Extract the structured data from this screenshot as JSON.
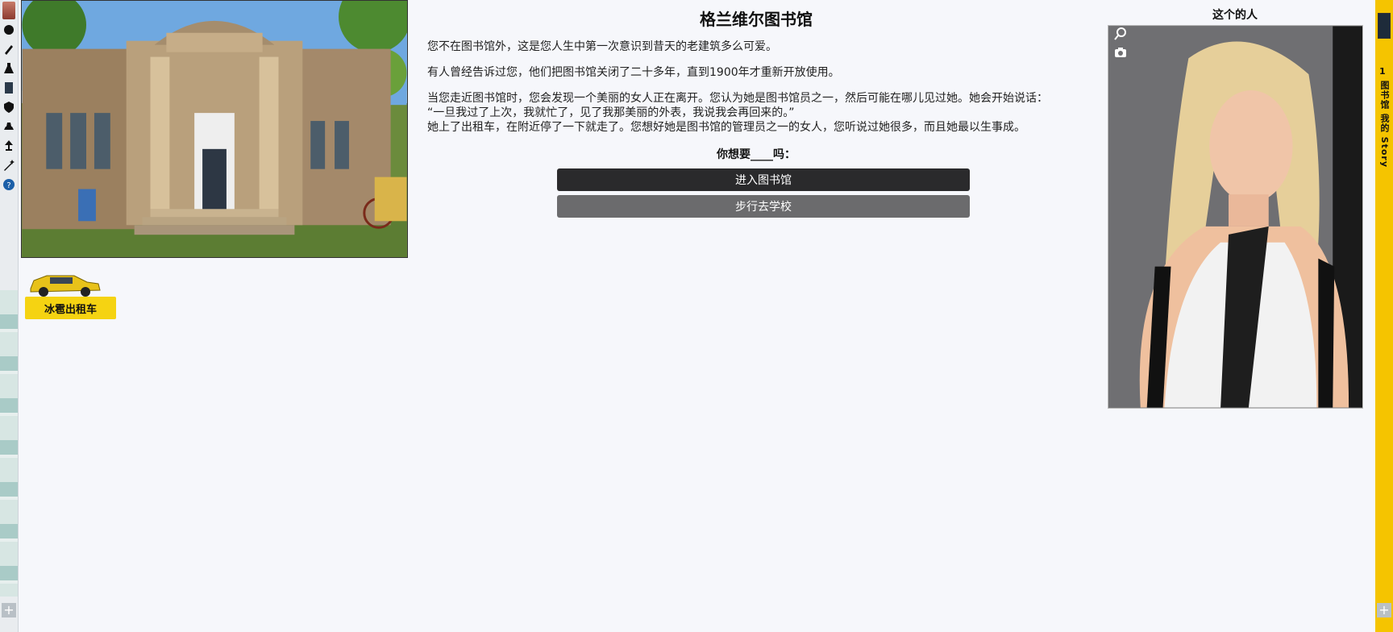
{
  "page": {
    "title": "格兰维尔图书馆",
    "paragraphs": [
      "您不在图书馆外，这是您人生中第一次意识到昔天的老建筑多么可爱。",
      "有人曾经告诉过您，他们把图书馆关闭了二十多年，直到1900年才重新开放使用。",
      "当您走近图书馆时，您会发现一个美丽的女人正在离开。您认为她是图书馆员之一，然后可能在哪儿见过她。她会开始说话："
    ],
    "quote_line": "“一旦我过了上次，我就忙了，见了我那美丽的外表，我说我会再回来的。”",
    "closing_line": "她上了出租车，在附近停了一下就走了。您想好她是图书馆的管理员之一的女人，您听说过她很多，而且她最以生事成。",
    "prompt": "你想要____吗：",
    "actions": {
      "enter": "进入图书馆",
      "walk": "步行去学校"
    }
  },
  "taxi": {
    "button_label": "冰雹出租车"
  },
  "portrait": {
    "title": "这个的人"
  },
  "right_bar": {
    "count": "1",
    "label": "图书馆 我的 Story"
  },
  "colors": {
    "accent_yellow": "#f5c400",
    "taxi_yellow": "#f5d312",
    "dark_button": "#2a2a2c",
    "grey_button": "#6b6b6d"
  },
  "icons": [
    "avatar-icon",
    "circle-icon",
    "pencil-icon",
    "flask-icon",
    "book-icon",
    "shield-icon",
    "help-icon",
    "zoom-icon",
    "camera-icon",
    "plus-icon"
  ]
}
